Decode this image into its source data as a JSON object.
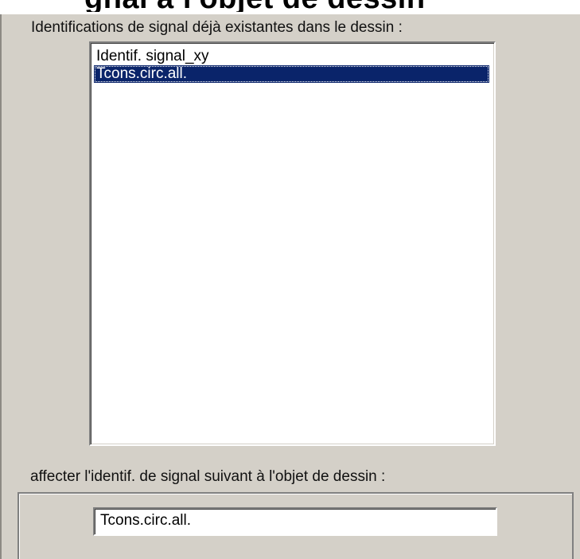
{
  "header": {
    "title": "gnal à l'objet de dessin"
  },
  "signal_list": {
    "label": "Identifications de signal déjà existantes dans le dessin :",
    "items": [
      {
        "label": "Identif. signal_xy",
        "selected": false
      },
      {
        "label": "Tcons.circ.all.",
        "selected": true
      }
    ]
  },
  "assign_group": {
    "label": "affecter l'identif. de signal suivant à l'objet de dessin :",
    "input_value": "Tcons.circ.all."
  },
  "colors": {
    "dialog_background": "#d4d0c8",
    "selection_background": "#0a246a",
    "selection_text": "#ffffff"
  }
}
